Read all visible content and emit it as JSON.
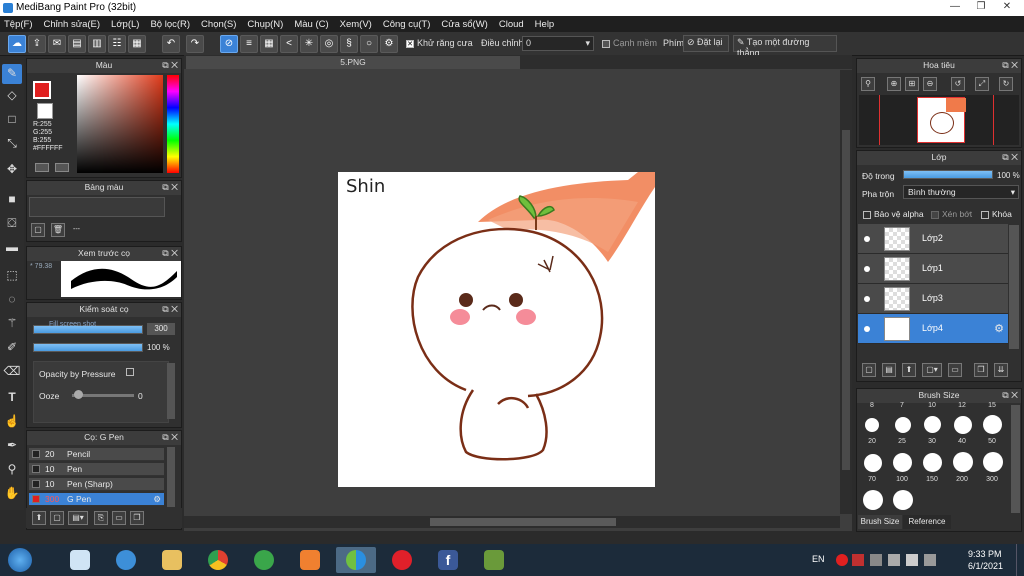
{
  "app": {
    "title": "MediBang Paint Pro (32bit)"
  },
  "menu": [
    "Tệp(F)",
    "Chỉnh sửa(E)",
    "Lớp(L)",
    "Bộ lọc(R)",
    "Chọn(S)",
    "Chụp(N)",
    "Màu (C)",
    "Xem(V)",
    "Công cụ(T)",
    "Cửa sổ(W)",
    "Cloud",
    "Help"
  ],
  "toolbar": {
    "antialias_label": "Khử răng cưa",
    "adjust_label": "Điều chỉnh",
    "adjust_value": "0",
    "edge_label": "Cạnh mềm",
    "key_label": "Phím",
    "reset_label": "Đặt lại",
    "straight_label": "Tạo một đường thẳng"
  },
  "color_panel": {
    "title": "Màu",
    "r": "R:255",
    "g": "G:255",
    "b": "B:255",
    "hex": "#FFFFFF"
  },
  "palette_panel": {
    "title": "Bảng màu",
    "dashes": "---"
  },
  "brush_preview": {
    "title": "Xem trước cọ",
    "size": "79.38"
  },
  "brush_control": {
    "title": "Kiểm soát cọ",
    "size_value": "300",
    "opacity_value": "100 %",
    "opacity_pressure_label": "Opacity by Pressure",
    "ooze_label": "Ooze",
    "ooze_value": "0",
    "hint": "Fill screen shot"
  },
  "brush_list": {
    "title": "Cọ: G Pen",
    "items": [
      {
        "size": "20",
        "name": "Pencil"
      },
      {
        "size": "10",
        "name": "Pen"
      },
      {
        "size": "10",
        "name": "Pen (Sharp)"
      },
      {
        "size": "300",
        "name": "G Pen"
      }
    ]
  },
  "document": {
    "tab": "5.PNG",
    "canvas_text": "Shin"
  },
  "navigator": {
    "title": "Hoa tiêu"
  },
  "layers": {
    "title": "Lớp",
    "opacity_label": "Độ trong",
    "opacity_value": "100 %",
    "blend_label": "Pha trộn",
    "blend_value": "Bình thường",
    "protect_alpha": "Bảo vệ alpha",
    "clip": "Xén bớt",
    "lock": "Khóa",
    "items": [
      "Lớp2",
      "Lớp1",
      "Lớp3",
      "Lớp4"
    ]
  },
  "brush_size": {
    "title": "Brush Size",
    "top_row": [
      "8",
      "7",
      "10",
      "12",
      "15"
    ],
    "row1": [
      "20",
      "25",
      "30",
      "40",
      "50"
    ],
    "row2": [
      "70",
      "100",
      "150",
      "200",
      "300"
    ],
    "tab1": "Brush Size",
    "tab2": "Reference"
  },
  "taskbar": {
    "lang": "EN",
    "time": "9:33 PM",
    "date": "6/1/2021"
  },
  "colors": {
    "accent": "#3b82d6",
    "taskbar": "#1c2b3a"
  }
}
